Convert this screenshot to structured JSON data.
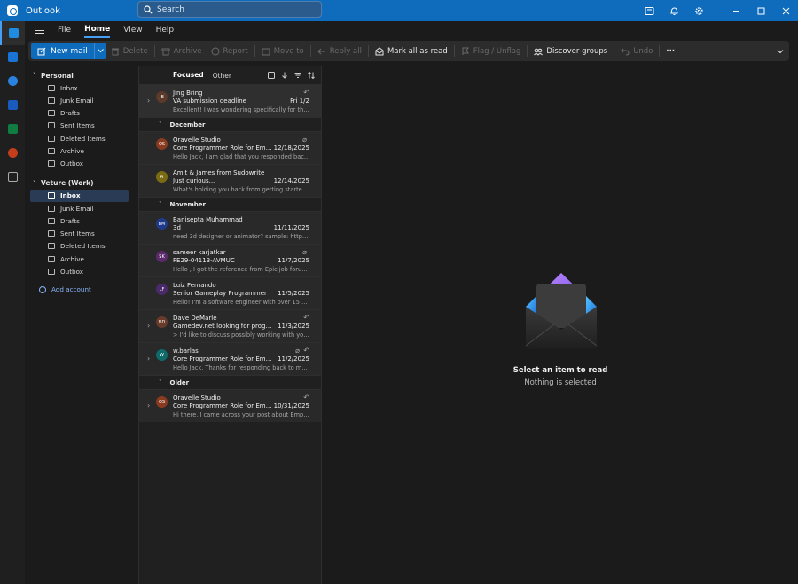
{
  "app": {
    "title": "Outlook"
  },
  "search": {
    "placeholder": "Search"
  },
  "menu": {
    "tabs": [
      "File",
      "Home",
      "View",
      "Help"
    ]
  },
  "ribbon": {
    "new_mail": "New mail",
    "delete": "Delete",
    "archive": "Archive",
    "report": "Report",
    "move_to": "Move to",
    "reply_all": "Reply all",
    "mark_all_read": "Mark all as read",
    "flag_unflag": "Flag / Unflag",
    "discover_groups": "Discover groups",
    "undo": "Undo",
    "more": "···"
  },
  "accounts": [
    {
      "name": "Personal",
      "folders": [
        "Inbox",
        "Junk Email",
        "Drafts",
        "Sent Items",
        "Deleted Items",
        "Archive",
        "Outbox"
      ]
    },
    {
      "name": "Veture (Work)",
      "folders": [
        "Inbox",
        "Junk Email",
        "Drafts",
        "Sent Items",
        "Deleted Items",
        "Archive",
        "Outbox"
      ]
    }
  ],
  "add_account": "Add account",
  "list": {
    "tabs": {
      "focused": "Focused",
      "other": "Other"
    },
    "top": {
      "initials": "JB",
      "sender": "Jing Bring",
      "subject": "VA submission deadline",
      "date": "Fri 1/2",
      "preview": "Excellent! I was wondering specifically for the S...",
      "avatar_color": "#5b3a29"
    },
    "groups": {
      "december": "December",
      "november": "November",
      "older": "Older"
    },
    "december": [
      {
        "initials": "OS",
        "sender": "Oravelle Studio",
        "subject": "Core Programmer Role for Empty...",
        "date": "12/18/2025",
        "preview": "Hello Jack, I am glad that you responded back t...",
        "avatar_color": "#8a3a1f"
      },
      {
        "initials": "A",
        "sender": "Amit & James from Sudowrite",
        "subject": "Just curious...",
        "date": "12/14/2025",
        "preview": "What's holding you back from getting started? ...",
        "avatar_color": "#7a6a12"
      }
    ],
    "november": [
      {
        "initials": "BM",
        "sender": "Banisepta Muhammad",
        "subject": "3d",
        "date": "11/11/2025",
        "preview": "need 3d designer or animator? sample: https:/...",
        "avatar_color": "#1f3a8a"
      },
      {
        "initials": "SK",
        "sender": "sameer karjatkar",
        "subject": "FE29-04113-AVMUC",
        "date": "11/7/2025",
        "preview": "Hello , I got the reference from Epic job forum ...",
        "avatar_color": "#5a2a6a"
      },
      {
        "initials": "LF",
        "sender": "Luiz Fernando",
        "subject": "Senior Gameplay Programmer",
        "date": "11/5/2025",
        "preview": "Hello! I'm a software engineer with over 15 year...",
        "avatar_color": "#4a2a6a"
      },
      {
        "initials": "DD",
        "sender": "Dave DeMarle",
        "subject": "Gamedev.net looking for program...",
        "date": "11/3/2025",
        "preview": "> I'd like to discuss possibly working with you ...",
        "avatar_color": "#6a3a2a"
      },
      {
        "initials": "W",
        "sender": "w.barlas",
        "subject": "Core Programmer Role for Empty ...",
        "date": "11/2/2025",
        "preview": "Hello Jack, Thanks for responding back to me. I ...",
        "avatar_color": "#0f6a6a"
      }
    ],
    "older": [
      {
        "initials": "OS",
        "sender": "Oravelle Studio",
        "subject": "Core Programmer Role for Empty...",
        "date": "10/31/2025",
        "preview": "Hi there, I came across your post about Empty ...",
        "avatar_color": "#8a3a1f"
      }
    ]
  },
  "reading": {
    "title": "Select an item to read",
    "subtitle": "Nothing is selected"
  },
  "colors": {
    "accent": "#0f6cbd",
    "link": "#479ef5"
  }
}
